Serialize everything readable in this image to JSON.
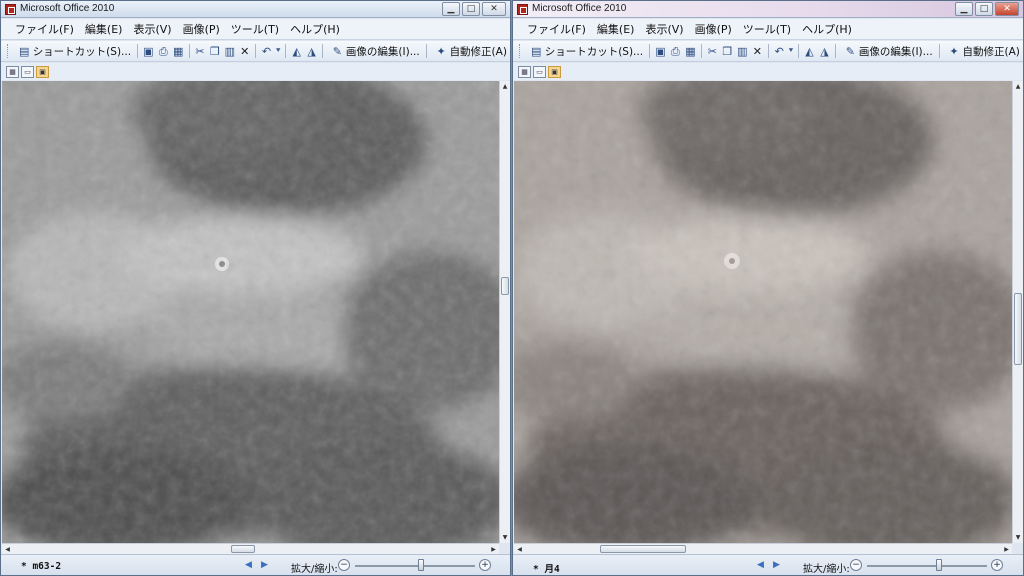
{
  "windows": {
    "left": {
      "title": "Microsoft Office 2010",
      "menu": [
        "ファイル(F)",
        "編集(E)",
        "表示(V)",
        "画像(P)",
        "ツール(T)",
        "ヘルプ(H)"
      ],
      "toolbar": {
        "shortcut": "ショートカット(S)...",
        "edit_image": "画像の編集(I)...",
        "auto_fix": "自動修正(A)"
      },
      "filename": "* m63-2",
      "zoom_label": "拡大/縮小:",
      "zoom_level": 0.55
    },
    "right": {
      "title": "Microsoft Office 2010",
      "menu": [
        "ファイル(F)",
        "編集(E)",
        "表示(V)",
        "画像(P)",
        "ツール(T)",
        "ヘルプ(H)"
      ],
      "toolbar": {
        "shortcut": "ショートカット(S)...",
        "edit_image": "画像の編集(I)...",
        "auto_fix": "自動修正(A)"
      },
      "filename": "* 月4",
      "zoom_label": "拡大/縮小:",
      "zoom_level": 0.6
    }
  },
  "icons": {
    "title_buttons": [
      "minimize-icon",
      "maximize-icon",
      "close-icon"
    ],
    "toolbar": [
      "save-icon",
      "print-icon",
      "scan-icon",
      "cut-icon",
      "copy-icon",
      "paste-icon",
      "delete-icon",
      "undo-icon",
      "rotate-left-icon",
      "rotate-right-icon"
    ],
    "view": [
      "thumbnail-view-icon",
      "filmstrip-view-icon",
      "single-view-icon"
    ]
  },
  "images": {
    "left": {
      "description_visual": "grayscale lunar surface closeup",
      "tint": "#8a8a8a"
    },
    "right": {
      "description_visual": "color lunar surface closeup",
      "tint": "#9c948f"
    }
  }
}
